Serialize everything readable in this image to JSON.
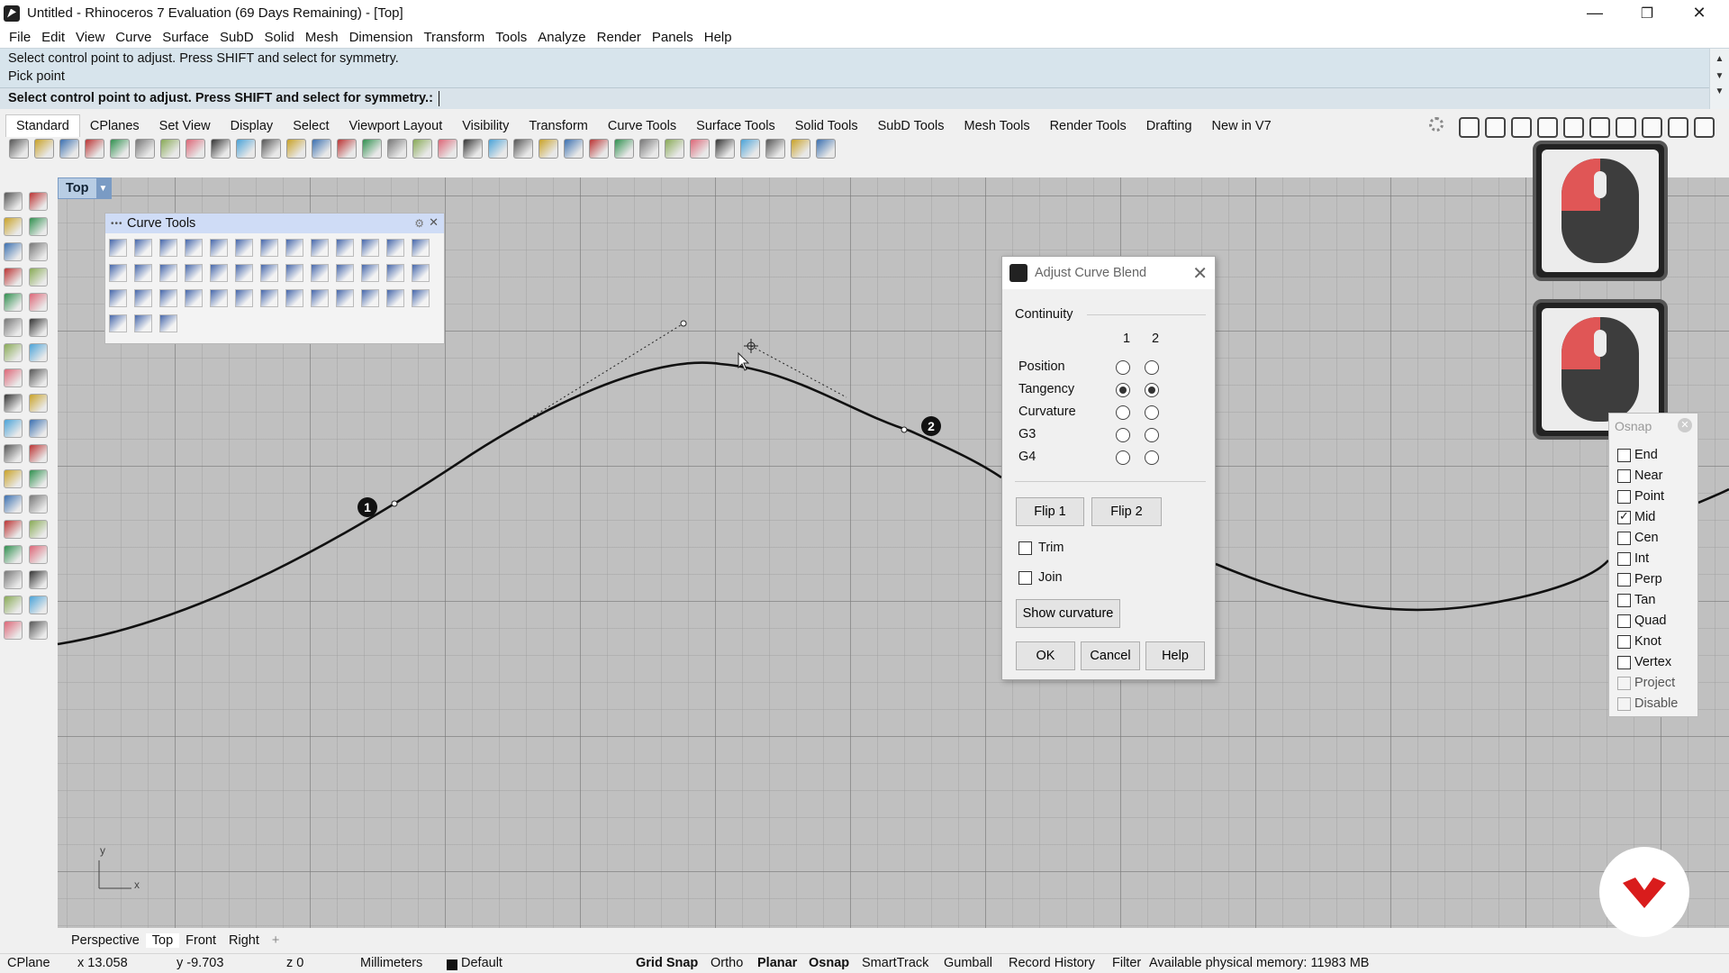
{
  "window": {
    "title": "Untitled - Rhinoceros 7 Evaluation (69 Days Remaining) - [Top]",
    "minimize": "—",
    "maximize": "❐",
    "close": "✕"
  },
  "menu": [
    "File",
    "Edit",
    "View",
    "Curve",
    "Surface",
    "SubD",
    "Solid",
    "Mesh",
    "Dimension",
    "Transform",
    "Tools",
    "Analyze",
    "Render",
    "Panels",
    "Help"
  ],
  "command": {
    "history": [
      "Select control point to adjust. Press SHIFT and select for symmetry.",
      "Pick point"
    ],
    "prompt": "Select control point to adjust. Press SHIFT and select for symmetry.:",
    "scroll_up": "▲",
    "scroll_down": "▼"
  },
  "toolbar_tabs": [
    "Standard",
    "CPlanes",
    "Set View",
    "Display",
    "Select",
    "Viewport Layout",
    "Visibility",
    "Transform",
    "Curve Tools",
    "Surface Tools",
    "Solid Tools",
    "SubD Tools",
    "Mesh Tools",
    "Render Tools",
    "Drafting",
    "New in V7"
  ],
  "viewport": {
    "name": "Top",
    "menu_arrow": "▼",
    "axis_x": "x",
    "axis_y": "y",
    "point_labels": [
      "1",
      "2"
    ]
  },
  "curve_tools_panel": {
    "title": "Curve Tools",
    "grip": "•••",
    "gear": "⚙",
    "close": "✕"
  },
  "dialog": {
    "title": "Adjust Curve Blend",
    "close": "✕",
    "section": "Continuity",
    "col1": "1",
    "col2": "2",
    "rows": [
      {
        "label": "Position",
        "c1": false,
        "c2": false
      },
      {
        "label": "Tangency",
        "c1": true,
        "c2": true
      },
      {
        "label": "Curvature",
        "c1": false,
        "c2": false
      },
      {
        "label": "G3",
        "c1": false,
        "c2": false
      },
      {
        "label": "G4",
        "c1": false,
        "c2": false
      }
    ],
    "flip1": "Flip 1",
    "flip2": "Flip 2",
    "trim_label": "Trim",
    "trim_checked": false,
    "join_label": "Join",
    "join_checked": false,
    "show_curvature": "Show curvature",
    "ok": "OK",
    "cancel": "Cancel",
    "help": "Help"
  },
  "osnap": {
    "title": "Osnap",
    "close": "✕",
    "items": [
      {
        "label": "End",
        "checked": false,
        "disabled": false
      },
      {
        "label": "Near",
        "checked": false,
        "disabled": false
      },
      {
        "label": "Point",
        "checked": false,
        "disabled": false
      },
      {
        "label": "Mid",
        "checked": true,
        "disabled": false
      },
      {
        "label": "Cen",
        "checked": false,
        "disabled": false
      },
      {
        "label": "Int",
        "checked": false,
        "disabled": false
      },
      {
        "label": "Perp",
        "checked": false,
        "disabled": false
      },
      {
        "label": "Tan",
        "checked": false,
        "disabled": false
      },
      {
        "label": "Quad",
        "checked": false,
        "disabled": false
      },
      {
        "label": "Knot",
        "checked": false,
        "disabled": false
      },
      {
        "label": "Vertex",
        "checked": false,
        "disabled": false
      },
      {
        "label": "Project",
        "checked": false,
        "disabled": true
      },
      {
        "label": "Disable",
        "checked": false,
        "disabled": true
      }
    ]
  },
  "viewport_tabs": [
    "Perspective",
    "Top",
    "Front",
    "Right"
  ],
  "viewport_tabs_add": "+",
  "status": {
    "cplane": "CPlane",
    "x": "x 13.058",
    "y": "y -9.703",
    "z": "z 0",
    "units": "Millimeters",
    "layer": "Default",
    "grid_snap": "Grid Snap",
    "ortho": "Ortho",
    "planar": "Planar",
    "osnap": "Osnap",
    "smarttrack": "SmartTrack",
    "gumball": "Gumball",
    "record_history": "Record History",
    "filter": "Filter",
    "memory": "Available physical memory: 11983 MB"
  },
  "colors": {
    "accent_red": "#e05656",
    "logo_red": "#d91c1c",
    "viewport_bg": "#c0c0c0",
    "command_bg": "#d7e4ec",
    "panel_title": "#cfdcf6"
  },
  "icons": {
    "app": "rhino-icon",
    "mouse": "mouse-icon",
    "logo": "rhino-logo-icon"
  }
}
